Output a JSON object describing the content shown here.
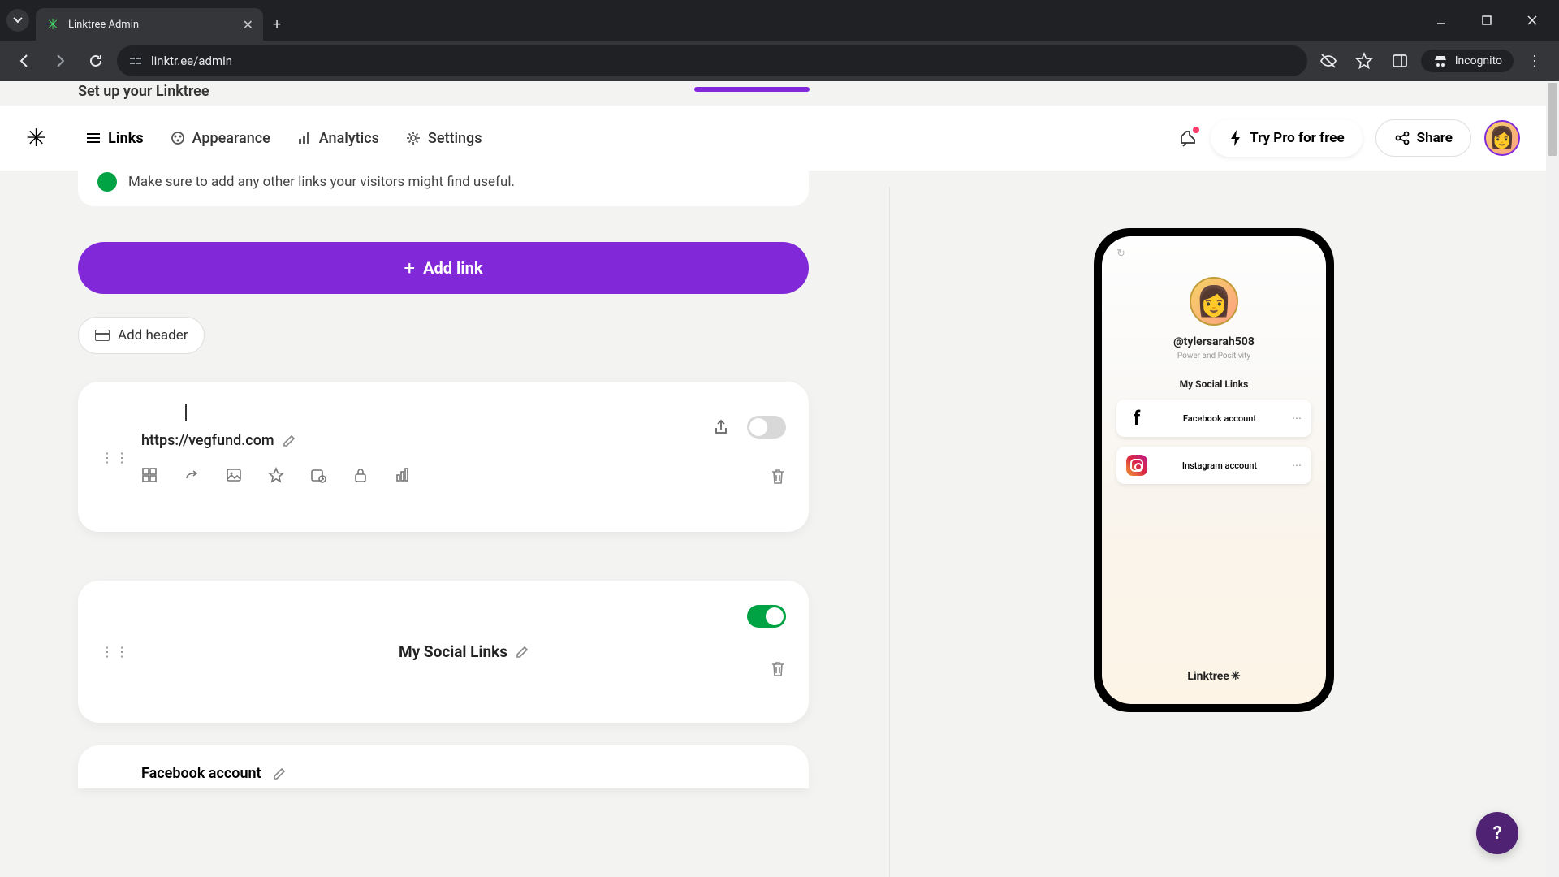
{
  "browser": {
    "tab_title": "Linktree Admin",
    "url": "linktr.ee/admin",
    "incognito_label": "Incognito"
  },
  "setup": {
    "title": "Set up your Linktree"
  },
  "nav": {
    "links": "Links",
    "appearance": "Appearance",
    "analytics": "Analytics",
    "settings": "Settings",
    "try_pro": "Try Pro for free",
    "share": "Share"
  },
  "info": {
    "text": "Make sure to add any other links your visitors might find useful."
  },
  "buttons": {
    "add_link": "Add link",
    "add_header": "Add header"
  },
  "link_card": {
    "url": "https://vegfund.com",
    "enabled": false
  },
  "header_card": {
    "title": "My Social Links",
    "enabled": true
  },
  "fb_card": {
    "title": "Facebook account"
  },
  "preview": {
    "handle": "@tylersarah508",
    "tagline": "Power and Positivity",
    "section": "My Social Links",
    "links": [
      {
        "label": "Facebook account"
      },
      {
        "label": "Instagram account"
      }
    ],
    "footer": "Linktree"
  },
  "help": "?"
}
